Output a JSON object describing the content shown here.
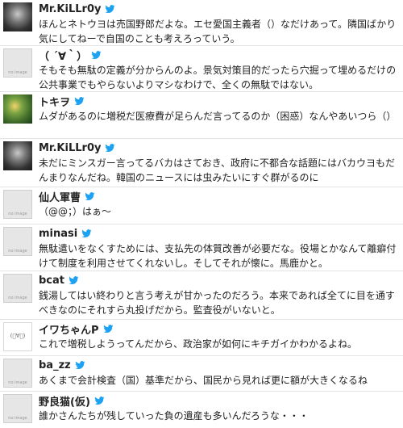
{
  "tweets": [
    {
      "name": "Mr.KiLLr0y",
      "avatar": "photo",
      "text": "ほんとネトウヨは売国野郎だよな。エセ愛国主義者（）なだけあって。隣国ばかり気にしてねーで自国のことも考えろっていう。"
    },
    {
      "name": "（ ´∀｀）",
      "avatar": "no-image",
      "text": "そもそも無駄の定義が分からんのよ。景気対策目的だったら穴掘って埋めるだけの公共事業でもやらないよりマシなわけで、全くの無駄ではない。"
    },
    {
      "name": "トキヲ",
      "avatar": "photo",
      "text": "ムダがあるのに増税だ医療費が足らんだ言ってるのか（困惑）なんやあいつら（）"
    },
    {
      "name": "Mr.KiLLr0y",
      "avatar": "photo",
      "text": "未だにミンスガー言ってるバカはさておき、政府に不都合な話題にはバカウヨもだんまりなんだね。韓国のニュースには虫みたいにすぐ群がるのに"
    },
    {
      "name": "仙人軍曹",
      "avatar": "no-image",
      "text": "（@@；）はぁ～"
    },
    {
      "name": "minasi",
      "avatar": "no-image",
      "text": "無駄遣いをなくすためには、支払先の体質改善が必要だな。役場とかなんて離癖付けて制度を利用させてくれないし。そしてそれが懐に。馬鹿かと。"
    },
    {
      "name": "bcat",
      "avatar": "no-image",
      "text": "銭湯してはい終わりと言う考えが甘かったのだろう。本来であれば全てに目を通すべきなのにそれすら丸投げだから。監査役がいないと。"
    },
    {
      "name": "イワちゃんP",
      "avatar": "kaomoji",
      "text": "これで増税しようってんだから、政治家が如何にキチガイかわかるよね。"
    },
    {
      "name": "ba_zz",
      "avatar": "no-image",
      "text": "あくまで会計検査（国）基準だから、国民から見れば更に額が大きくなるね"
    },
    {
      "name": "野良猫(仮)",
      "avatar": "no-image",
      "text": "誰かさんたちが残していった負の遺産も多いんだろうな・・・"
    }
  ],
  "labels": {
    "no_image": "no image",
    "kaomoji": "(ﾟ∀ﾟ)"
  },
  "icons": {
    "verified": "twitter-bird-icon"
  },
  "colors": {
    "bird": "#1da1f2",
    "divider": "#e1e4e6"
  }
}
